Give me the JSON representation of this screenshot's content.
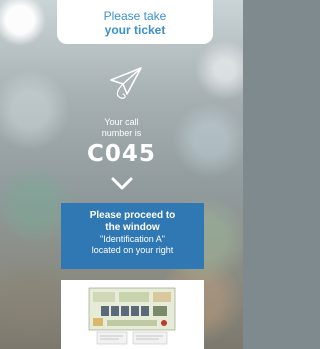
{
  "header": {
    "line1": "Please take",
    "line2": "your ticket"
  },
  "call": {
    "label_line1": "Your call",
    "label_line2": "number is",
    "number": "C045"
  },
  "direction": {
    "line1": "Please proceed to",
    "line2": "the window",
    "line3": "\"Identification A\"",
    "line4": "located on your right"
  },
  "icons": [
    "paper-plane-icon",
    "chevron-down-icon"
  ],
  "colors": {
    "accent": "#3b8fd0",
    "panel_blue": "#2f78b4",
    "white": "#ffffff"
  }
}
